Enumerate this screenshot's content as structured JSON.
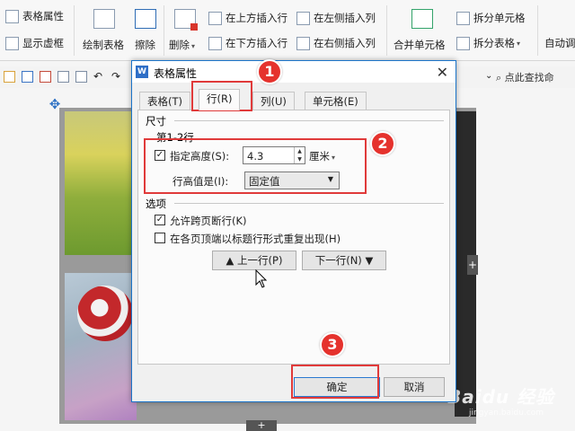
{
  "ribbon": {
    "table_props": "表格属性",
    "show_gridlines": "显示虚框",
    "draw_table": "绘制表格",
    "eraser": "擦除",
    "delete": "删除",
    "insert_above": "在上方插入行",
    "insert_below": "在下方插入行",
    "insert_left": "在左侧插入列",
    "insert_right": "在右侧插入列",
    "merge_cells": "合并单元格",
    "split_cells": "拆分单元格",
    "split_table": "拆分表格",
    "auto_adjust": "自动调"
  },
  "toolbar": {
    "search": "点此查找命"
  },
  "dialog": {
    "title": "表格属性",
    "tabs": [
      "表格(T)",
      "行(R)",
      "列(U)",
      "单元格(E)"
    ],
    "size_label": "尺寸",
    "row_range": "第1-2行",
    "specify_height_label": "指定高度(S):",
    "height_value": "4.3",
    "unit": "厘米",
    "row_height_is_label": "行高值是(I):",
    "row_height_mode": "固定值",
    "options_label": "选项",
    "allow_break": "允许跨页断行(K)",
    "repeat_header": "在各页顶端以标题行形式重复出现(H)",
    "prev_row": "上一行(P)",
    "next_row": "下一行(N)",
    "ok": "确定",
    "cancel": "取消"
  },
  "annotations": {
    "badge1": "1",
    "badge2": "2",
    "badge3": "3"
  },
  "watermark": {
    "logo": "Baidu 经验",
    "url": "jingyan.baidu.com"
  },
  "colors": {
    "annotation_red": "#e03a3a",
    "dialog_border": "#1b74c9"
  }
}
